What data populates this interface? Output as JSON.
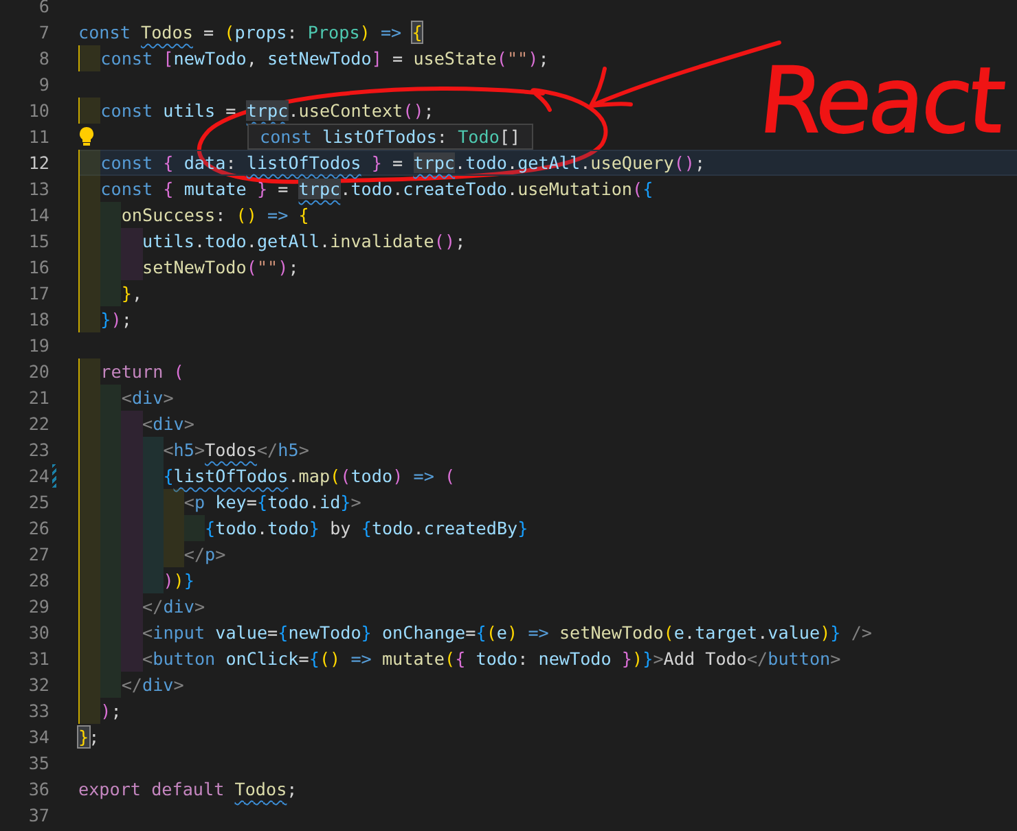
{
  "editor": {
    "lines": [
      {
        "number": "6",
        "current": false
      },
      {
        "number": "7",
        "current": false,
        "tokens": [
          {
            "t": "const ",
            "kind": "kw"
          },
          {
            "t": "Todos",
            "kind": "fn-sq"
          },
          {
            "t": " = ",
            "kind": "plain"
          },
          {
            "t": "(",
            "kind": "b1"
          },
          {
            "t": "props",
            "kind": "var"
          },
          {
            "t": ": ",
            "kind": "plain"
          },
          {
            "t": "Props",
            "kind": "type"
          },
          {
            "t": ")",
            "kind": "b1"
          },
          {
            "t": " => ",
            "kind": "kw"
          },
          {
            "t": "{",
            "kind": "b1-hl"
          }
        ]
      },
      {
        "number": "8",
        "current": false,
        "tokens": [
          {
            "t": "  const ",
            "kind": "kw"
          },
          {
            "t": "[",
            "kind": "b2"
          },
          {
            "t": "newTodo",
            "kind": "var"
          },
          {
            "t": ", ",
            "kind": "plain"
          },
          {
            "t": "setNewTodo",
            "kind": "var"
          },
          {
            "t": "]",
            "kind": "b2"
          },
          {
            "t": " = ",
            "kind": "plain"
          },
          {
            "t": "useState",
            "kind": "fn"
          },
          {
            "t": "(",
            "kind": "b2"
          },
          {
            "t": "\"\"",
            "kind": "str"
          },
          {
            "t": ")",
            "kind": "b2"
          },
          {
            "t": ";",
            "kind": "plain"
          }
        ]
      },
      {
        "number": "9",
        "current": false
      },
      {
        "number": "10",
        "current": false,
        "tokens": [
          {
            "t": "  const ",
            "kind": "kw"
          },
          {
            "t": "utils",
            "kind": "var"
          },
          {
            "t": " = ",
            "kind": "plain"
          },
          {
            "t": "trpc",
            "kind": "var-hl-sq"
          },
          {
            "t": ".",
            "kind": "plain"
          },
          {
            "t": "useContext",
            "kind": "fn"
          },
          {
            "t": "()",
            "kind": "b2"
          },
          {
            "t": ";",
            "kind": "plain"
          }
        ]
      },
      {
        "number": "11",
        "current": false,
        "gutter": {
          "kind": "lightbulb"
        }
      },
      {
        "number": "12",
        "current": true,
        "tokens": [
          {
            "t": "  const ",
            "kind": "kw"
          },
          {
            "t": "{",
            "kind": "b2"
          },
          {
            "t": " data",
            "kind": "var"
          },
          {
            "t": ": ",
            "kind": "plain"
          },
          {
            "t": "listOfTodos",
            "kind": "var-sq"
          },
          {
            "t": " }",
            "kind": "b2"
          },
          {
            "t": " = ",
            "kind": "plain"
          },
          {
            "t": "trpc",
            "kind": "var-hl-sq"
          },
          {
            "t": ".",
            "kind": "plain"
          },
          {
            "t": "todo",
            "kind": "var"
          },
          {
            "t": ".",
            "kind": "plain"
          },
          {
            "t": "getAll",
            "kind": "var"
          },
          {
            "t": ".",
            "kind": "plain"
          },
          {
            "t": "useQuery",
            "kind": "fn"
          },
          {
            "t": "()",
            "kind": "b2"
          },
          {
            "t": ";",
            "kind": "plain"
          }
        ]
      },
      {
        "number": "13",
        "current": false,
        "tokens": [
          {
            "t": "  const ",
            "kind": "kw"
          },
          {
            "t": "{",
            "kind": "b2"
          },
          {
            "t": " mutate ",
            "kind": "var"
          },
          {
            "t": "}",
            "kind": "b2"
          },
          {
            "t": " = ",
            "kind": "plain"
          },
          {
            "t": "trpc",
            "kind": "var-hl-sq"
          },
          {
            "t": ".",
            "kind": "plain"
          },
          {
            "t": "todo",
            "kind": "var"
          },
          {
            "t": ".",
            "kind": "plain"
          },
          {
            "t": "createTodo",
            "kind": "var"
          },
          {
            "t": ".",
            "kind": "plain"
          },
          {
            "t": "useMutation",
            "kind": "fn"
          },
          {
            "t": "(",
            "kind": "b2"
          },
          {
            "t": "{",
            "kind": "b3"
          }
        ]
      },
      {
        "number": "14",
        "current": false,
        "tokens": [
          {
            "t": "    onSuccess",
            "kind": "fn"
          },
          {
            "t": ": ",
            "kind": "plain"
          },
          {
            "t": "()",
            "kind": "b1"
          },
          {
            "t": " => ",
            "kind": "kw"
          },
          {
            "t": "{",
            "kind": "b1"
          }
        ]
      },
      {
        "number": "15",
        "current": false,
        "tokens": [
          {
            "t": "      utils",
            "kind": "var"
          },
          {
            "t": ".",
            "kind": "plain"
          },
          {
            "t": "todo",
            "kind": "var"
          },
          {
            "t": ".",
            "kind": "plain"
          },
          {
            "t": "getAll",
            "kind": "var"
          },
          {
            "t": ".",
            "kind": "plain"
          },
          {
            "t": "invalidate",
            "kind": "fn"
          },
          {
            "t": "()",
            "kind": "b2"
          },
          {
            "t": ";",
            "kind": "plain"
          }
        ]
      },
      {
        "number": "16",
        "current": false,
        "tokens": [
          {
            "t": "      setNewTodo",
            "kind": "fn"
          },
          {
            "t": "(",
            "kind": "b2"
          },
          {
            "t": "\"\"",
            "kind": "str"
          },
          {
            "t": ")",
            "kind": "b2"
          },
          {
            "t": ";",
            "kind": "plain"
          }
        ]
      },
      {
        "number": "17",
        "current": false,
        "tokens": [
          {
            "t": "    }",
            "kind": "b1"
          },
          {
            "t": ",",
            "kind": "plain"
          }
        ]
      },
      {
        "number": "18",
        "current": false,
        "tokens": [
          {
            "t": "  }",
            "kind": "b3"
          },
          {
            "t": ")",
            "kind": "b2"
          },
          {
            "t": ";",
            "kind": "plain"
          }
        ]
      },
      {
        "number": "19",
        "current": false
      },
      {
        "number": "20",
        "current": false,
        "tokens": [
          {
            "t": "  return ",
            "kind": "ctrl"
          },
          {
            "t": "(",
            "kind": "b2"
          }
        ]
      },
      {
        "number": "21",
        "current": false,
        "tokens": [
          {
            "t": "    <",
            "kind": "tag"
          },
          {
            "t": "div",
            "kind": "kw"
          },
          {
            "t": ">",
            "kind": "tag"
          }
        ]
      },
      {
        "number": "22",
        "current": false,
        "tokens": [
          {
            "t": "      <",
            "kind": "tag"
          },
          {
            "t": "div",
            "kind": "kw"
          },
          {
            "t": ">",
            "kind": "tag"
          }
        ]
      },
      {
        "number": "23",
        "current": false,
        "tokens": [
          {
            "t": "        <",
            "kind": "tag"
          },
          {
            "t": "h5",
            "kind": "kw"
          },
          {
            "t": ">",
            "kind": "tag"
          },
          {
            "t": "Todos",
            "kind": "plain-sq"
          },
          {
            "t": "</",
            "kind": "tag"
          },
          {
            "t": "h5",
            "kind": "kw"
          },
          {
            "t": ">",
            "kind": "tag"
          }
        ]
      },
      {
        "number": "24",
        "current": false,
        "gutter": {
          "kind": "modified"
        },
        "tokens": [
          {
            "t": "        {",
            "kind": "b3"
          },
          {
            "t": "listOfTodos",
            "kind": "var-sq"
          },
          {
            "t": ".",
            "kind": "plain"
          },
          {
            "t": "map",
            "kind": "fn"
          },
          {
            "t": "(",
            "kind": "b1"
          },
          {
            "t": "(",
            "kind": "b2"
          },
          {
            "t": "todo",
            "kind": "var"
          },
          {
            "t": ")",
            "kind": "b2"
          },
          {
            "t": " => ",
            "kind": "kw"
          },
          {
            "t": "(",
            "kind": "b2"
          }
        ]
      },
      {
        "number": "25",
        "current": false,
        "tokens": [
          {
            "t": "          <",
            "kind": "tag"
          },
          {
            "t": "p ",
            "kind": "kw"
          },
          {
            "t": "key",
            "kind": "var"
          },
          {
            "t": "=",
            "kind": "plain"
          },
          {
            "t": "{",
            "kind": "b3"
          },
          {
            "t": "todo",
            "kind": "var"
          },
          {
            "t": ".",
            "kind": "plain"
          },
          {
            "t": "id",
            "kind": "var"
          },
          {
            "t": "}",
            "kind": "b3"
          },
          {
            "t": ">",
            "kind": "tag"
          }
        ]
      },
      {
        "number": "26",
        "current": false,
        "tokens": [
          {
            "t": "            {",
            "kind": "b3"
          },
          {
            "t": "todo",
            "kind": "var"
          },
          {
            "t": ".",
            "kind": "plain"
          },
          {
            "t": "todo",
            "kind": "var"
          },
          {
            "t": "}",
            "kind": "b3"
          },
          {
            "t": " by ",
            "kind": "plain"
          },
          {
            "t": "{",
            "kind": "b3"
          },
          {
            "t": "todo",
            "kind": "var"
          },
          {
            "t": ".",
            "kind": "plain"
          },
          {
            "t": "createdBy",
            "kind": "var"
          },
          {
            "t": "}",
            "kind": "b3"
          }
        ]
      },
      {
        "number": "27",
        "current": false,
        "tokens": [
          {
            "t": "          </",
            "kind": "tag"
          },
          {
            "t": "p",
            "kind": "kw"
          },
          {
            "t": ">",
            "kind": "tag"
          }
        ]
      },
      {
        "number": "28",
        "current": false,
        "tokens": [
          {
            "t": "        )",
            "kind": "b2"
          },
          {
            "t": ")",
            "kind": "b1"
          },
          {
            "t": "}",
            "kind": "b3"
          }
        ]
      },
      {
        "number": "29",
        "current": false,
        "tokens": [
          {
            "t": "      </",
            "kind": "tag"
          },
          {
            "t": "div",
            "kind": "kw"
          },
          {
            "t": ">",
            "kind": "tag"
          }
        ]
      },
      {
        "number": "30",
        "current": false,
        "tokens": [
          {
            "t": "      <",
            "kind": "tag"
          },
          {
            "t": "input ",
            "kind": "kw"
          },
          {
            "t": "value",
            "kind": "var"
          },
          {
            "t": "=",
            "kind": "plain"
          },
          {
            "t": "{",
            "kind": "b3"
          },
          {
            "t": "newTodo",
            "kind": "var"
          },
          {
            "t": "} ",
            "kind": "b3"
          },
          {
            "t": "onChange",
            "kind": "var"
          },
          {
            "t": "=",
            "kind": "plain"
          },
          {
            "t": "{",
            "kind": "b3"
          },
          {
            "t": "(",
            "kind": "b1"
          },
          {
            "t": "e",
            "kind": "var"
          },
          {
            "t": ")",
            "kind": "b1"
          },
          {
            "t": " => ",
            "kind": "kw"
          },
          {
            "t": "setNewTodo",
            "kind": "fn"
          },
          {
            "t": "(",
            "kind": "b1"
          },
          {
            "t": "e",
            "kind": "var"
          },
          {
            "t": ".",
            "kind": "plain"
          },
          {
            "t": "target",
            "kind": "var"
          },
          {
            "t": ".",
            "kind": "plain"
          },
          {
            "t": "value",
            "kind": "var"
          },
          {
            "t": ")",
            "kind": "b1"
          },
          {
            "t": "} ",
            "kind": "b3"
          },
          {
            "t": "/>",
            "kind": "tag"
          }
        ]
      },
      {
        "number": "31",
        "current": false,
        "tokens": [
          {
            "t": "      <",
            "kind": "tag"
          },
          {
            "t": "button ",
            "kind": "kw"
          },
          {
            "t": "onClick",
            "kind": "var"
          },
          {
            "t": "=",
            "kind": "plain"
          },
          {
            "t": "{",
            "kind": "b3"
          },
          {
            "t": "()",
            "kind": "b1"
          },
          {
            "t": " => ",
            "kind": "kw"
          },
          {
            "t": "mutate",
            "kind": "fn"
          },
          {
            "t": "(",
            "kind": "b1"
          },
          {
            "t": "{ ",
            "kind": "b2"
          },
          {
            "t": "todo",
            "kind": "var"
          },
          {
            "t": ": ",
            "kind": "plain"
          },
          {
            "t": "newTodo ",
            "kind": "var"
          },
          {
            "t": "}",
            "kind": "b2"
          },
          {
            "t": ")",
            "kind": "b1"
          },
          {
            "t": "}",
            "kind": "b3"
          },
          {
            "t": ">",
            "kind": "tag"
          },
          {
            "t": "Add Todo",
            "kind": "plain"
          },
          {
            "t": "</",
            "kind": "tag"
          },
          {
            "t": "button",
            "kind": "kw"
          },
          {
            "t": ">",
            "kind": "tag"
          }
        ]
      },
      {
        "number": "32",
        "current": false,
        "tokens": [
          {
            "t": "    </",
            "kind": "tag"
          },
          {
            "t": "div",
            "kind": "kw"
          },
          {
            "t": ">",
            "kind": "tag"
          }
        ]
      },
      {
        "number": "33",
        "current": false,
        "tokens": [
          {
            "t": "  )",
            "kind": "b2"
          },
          {
            "t": ";",
            "kind": "plain"
          }
        ]
      },
      {
        "number": "34",
        "current": false,
        "tokens": [
          {
            "t": "}",
            "kind": "b1-hl"
          },
          {
            "t": ";",
            "kind": "plain"
          }
        ]
      },
      {
        "number": "35",
        "current": false
      },
      {
        "number": "36",
        "current": false,
        "tokens": [
          {
            "t": "export ",
            "kind": "ctrl"
          },
          {
            "t": "default ",
            "kind": "ctrl"
          },
          {
            "t": "Todos",
            "kind": "fn-sq"
          },
          {
            "t": ";",
            "kind": "plain"
          }
        ]
      },
      {
        "number": "37",
        "current": false
      }
    ],
    "hover_tooltip": {
      "tokens": [
        {
          "t": "const ",
          "kind": "kw"
        },
        {
          "t": "listOfTodos",
          "kind": "var"
        },
        {
          "t": ": ",
          "kind": "plain"
        },
        {
          "t": "Todo",
          "kind": "type"
        },
        {
          "t": "[]",
          "kind": "plain"
        }
      ]
    }
  },
  "annotation": {
    "text": "React"
  }
}
